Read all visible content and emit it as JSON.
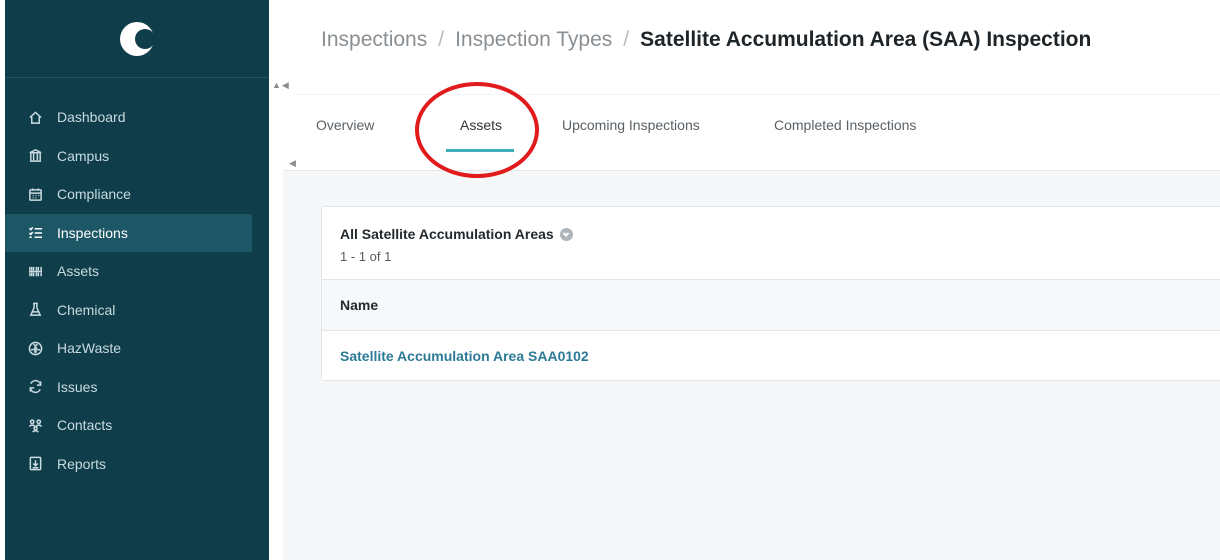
{
  "breadcrumb": {
    "items": [
      "Inspections",
      "Inspection Types"
    ],
    "separator": "/",
    "current": "Satellite Accumulation Area (SAA) Inspection"
  },
  "sidebar": {
    "items": [
      {
        "label": "Dashboard",
        "icon": "home-icon"
      },
      {
        "label": "Campus",
        "icon": "building-icon"
      },
      {
        "label": "Compliance",
        "icon": "calendar-icon"
      },
      {
        "label": "Inspections",
        "icon": "checklist-icon",
        "active": true
      },
      {
        "label": "Assets",
        "icon": "barcode-icon"
      },
      {
        "label": "Chemical",
        "icon": "flask-icon"
      },
      {
        "label": "HazWaste",
        "icon": "radiation-icon"
      },
      {
        "label": "Issues",
        "icon": "refresh-icon"
      },
      {
        "label": "Contacts",
        "icon": "contacts-icon"
      },
      {
        "label": "Reports",
        "icon": "report-icon"
      }
    ]
  },
  "tabs": {
    "items": [
      "Overview",
      "Assets",
      "Upcoming Inspections",
      "Completed Inspections"
    ],
    "active": "Assets"
  },
  "card": {
    "title": "All Satellite Accumulation Areas",
    "count": "1 - 1 of 1",
    "column": "Name",
    "rows": [
      "Satellite Accumulation Area SAA0102"
    ]
  },
  "colors": {
    "sidebar_bg": "#0f3d4a",
    "sidebar_active": "#1d5766",
    "accent": "#40aeb8",
    "link": "#2c7a97",
    "annotation": "#e11b1b"
  }
}
